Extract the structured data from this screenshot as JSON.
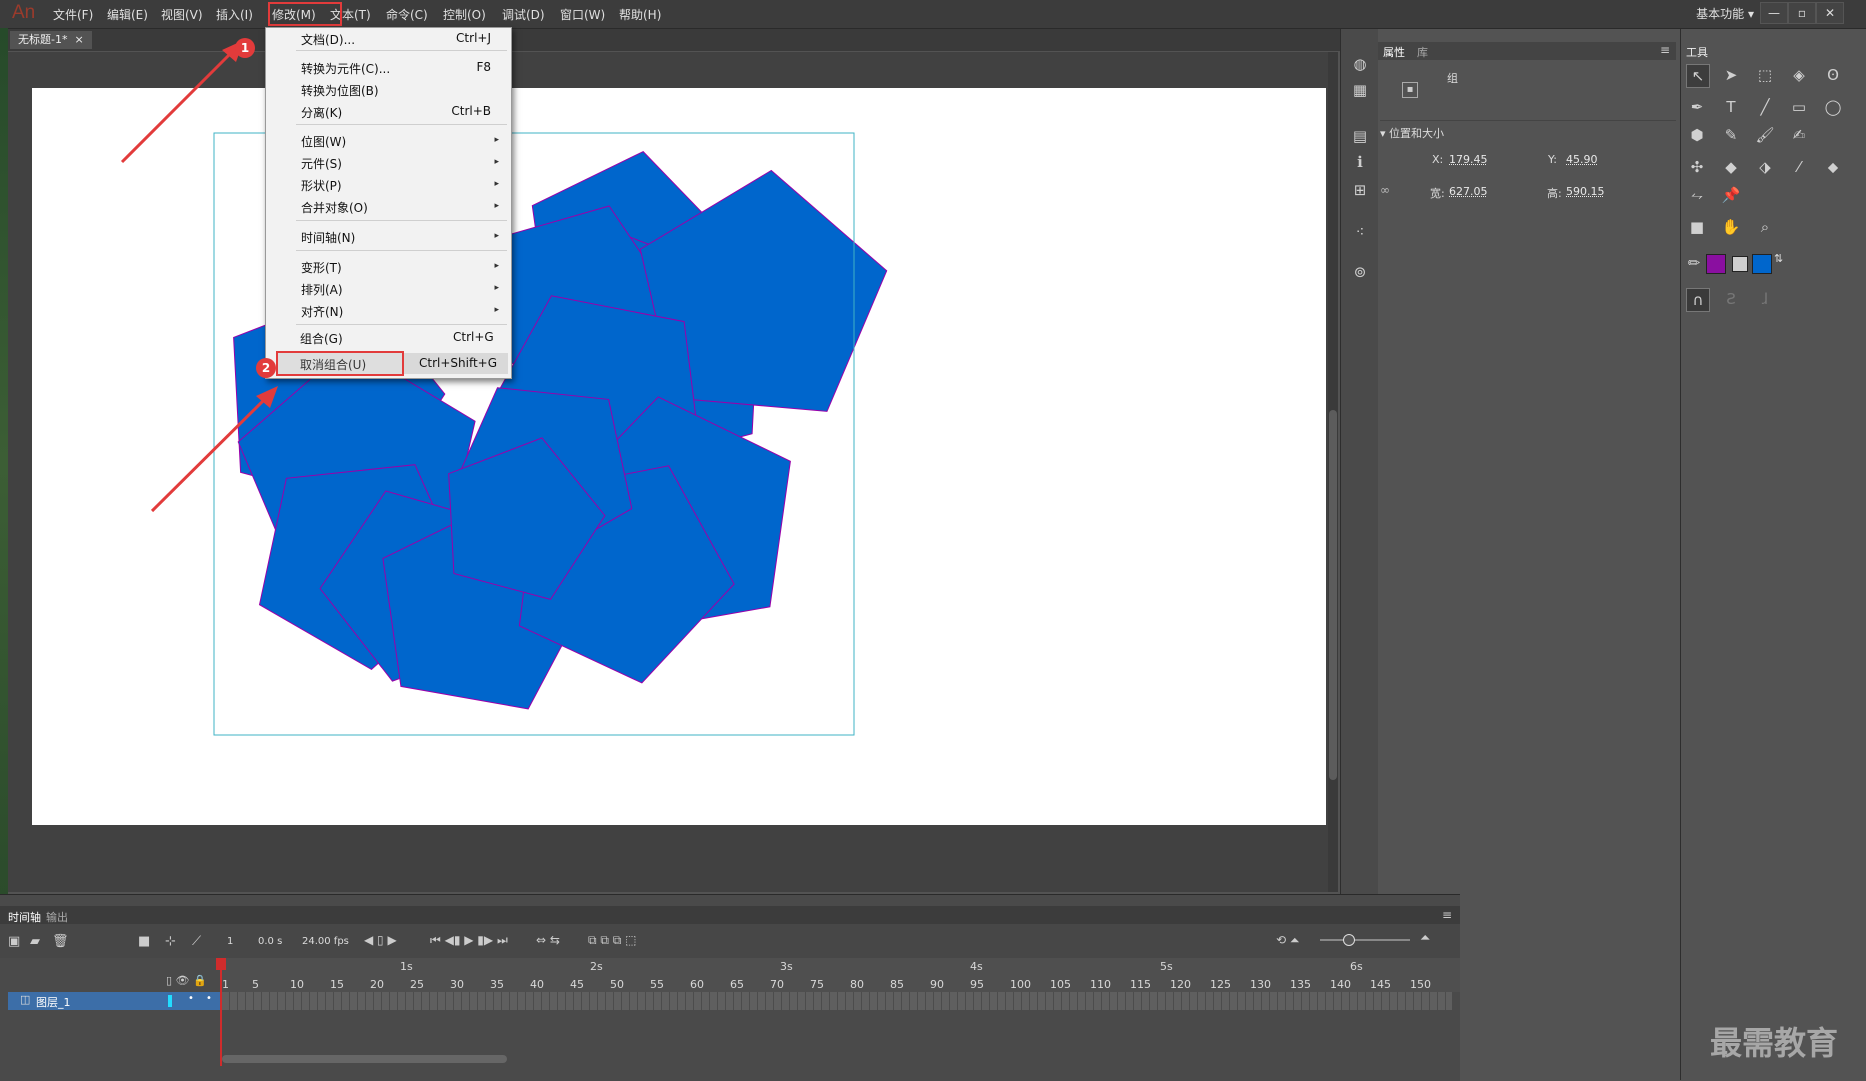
{
  "app": {
    "logo": "An",
    "workspace": "基本功能"
  },
  "menubar": {
    "items": [
      "文件(F)",
      "编辑(E)",
      "视图(V)",
      "插入(I)",
      "修改(M)",
      "文本(T)",
      "命令(C)",
      "控制(O)",
      "调试(D)",
      "窗口(W)",
      "帮助(H)"
    ]
  },
  "window_controls": {
    "minimize": "—",
    "restore": "▫",
    "close": "✕"
  },
  "document": {
    "tab": "无标题-1*",
    "tab_close": "×"
  },
  "modify_menu": {
    "items": [
      {
        "label": "文档(D)...",
        "shortcut": "Ctrl+J"
      },
      {
        "label": "转换为元件(C)...",
        "shortcut": "F8"
      },
      {
        "label": "转换为位图(B)",
        "shortcut": ""
      },
      {
        "label": "分离(K)",
        "shortcut": "Ctrl+B"
      },
      {
        "label": "位图(W)",
        "shortcut": ""
      },
      {
        "label": "元件(S)",
        "shortcut": ""
      },
      {
        "label": "形状(P)",
        "shortcut": ""
      },
      {
        "label": "合并对象(O)",
        "shortcut": ""
      },
      {
        "label": "时间轴(N)",
        "shortcut": ""
      },
      {
        "label": "变形(T)",
        "shortcut": ""
      },
      {
        "label": "排列(A)",
        "shortcut": ""
      },
      {
        "label": "对齐(N)",
        "shortcut": ""
      },
      {
        "label": "组合(G)",
        "shortcut": "Ctrl+G"
      },
      {
        "label": "取消组合(U)",
        "shortcut": "Ctrl+Shift+G"
      }
    ],
    "submenu_arrow": "▸"
  },
  "annotations": {
    "step1": "1",
    "step2": "2"
  },
  "properties": {
    "tabs": [
      "属性",
      "库"
    ],
    "object_type": "组",
    "section": "位置和大小",
    "x_label": "X:",
    "x_value": "179.45",
    "y_label": "Y:",
    "y_value": "45.90",
    "w_label": "宽:",
    "w_value": "627.05",
    "h_label": "高:",
    "h_value": "590.15"
  },
  "tools": {
    "title": "工具"
  },
  "timeline": {
    "tabs": [
      "时间轴",
      "输出"
    ],
    "current_frame": "1",
    "time": "0.0 s",
    "fps": "24.00 fps",
    "layer_name": "图层_1",
    "frame_numbers": [
      "1",
      "5",
      "10",
      "15",
      "20",
      "25",
      "30",
      "35",
      "40",
      "45",
      "50",
      "55",
      "60",
      "65",
      "70",
      "75",
      "80",
      "85",
      "90",
      "95",
      "100",
      "105",
      "110",
      "115",
      "120",
      "125",
      "130",
      "135",
      "140",
      "145",
      "150"
    ],
    "seconds": [
      "1s",
      "2s",
      "3s",
      "4s",
      "5s",
      "6s"
    ]
  },
  "colors": {
    "fill": "#0066cc",
    "stroke": "#9900aa",
    "stage_selection": "#3fb3c6",
    "annotation": "#e23b3b"
  },
  "watermark": "最需教育"
}
